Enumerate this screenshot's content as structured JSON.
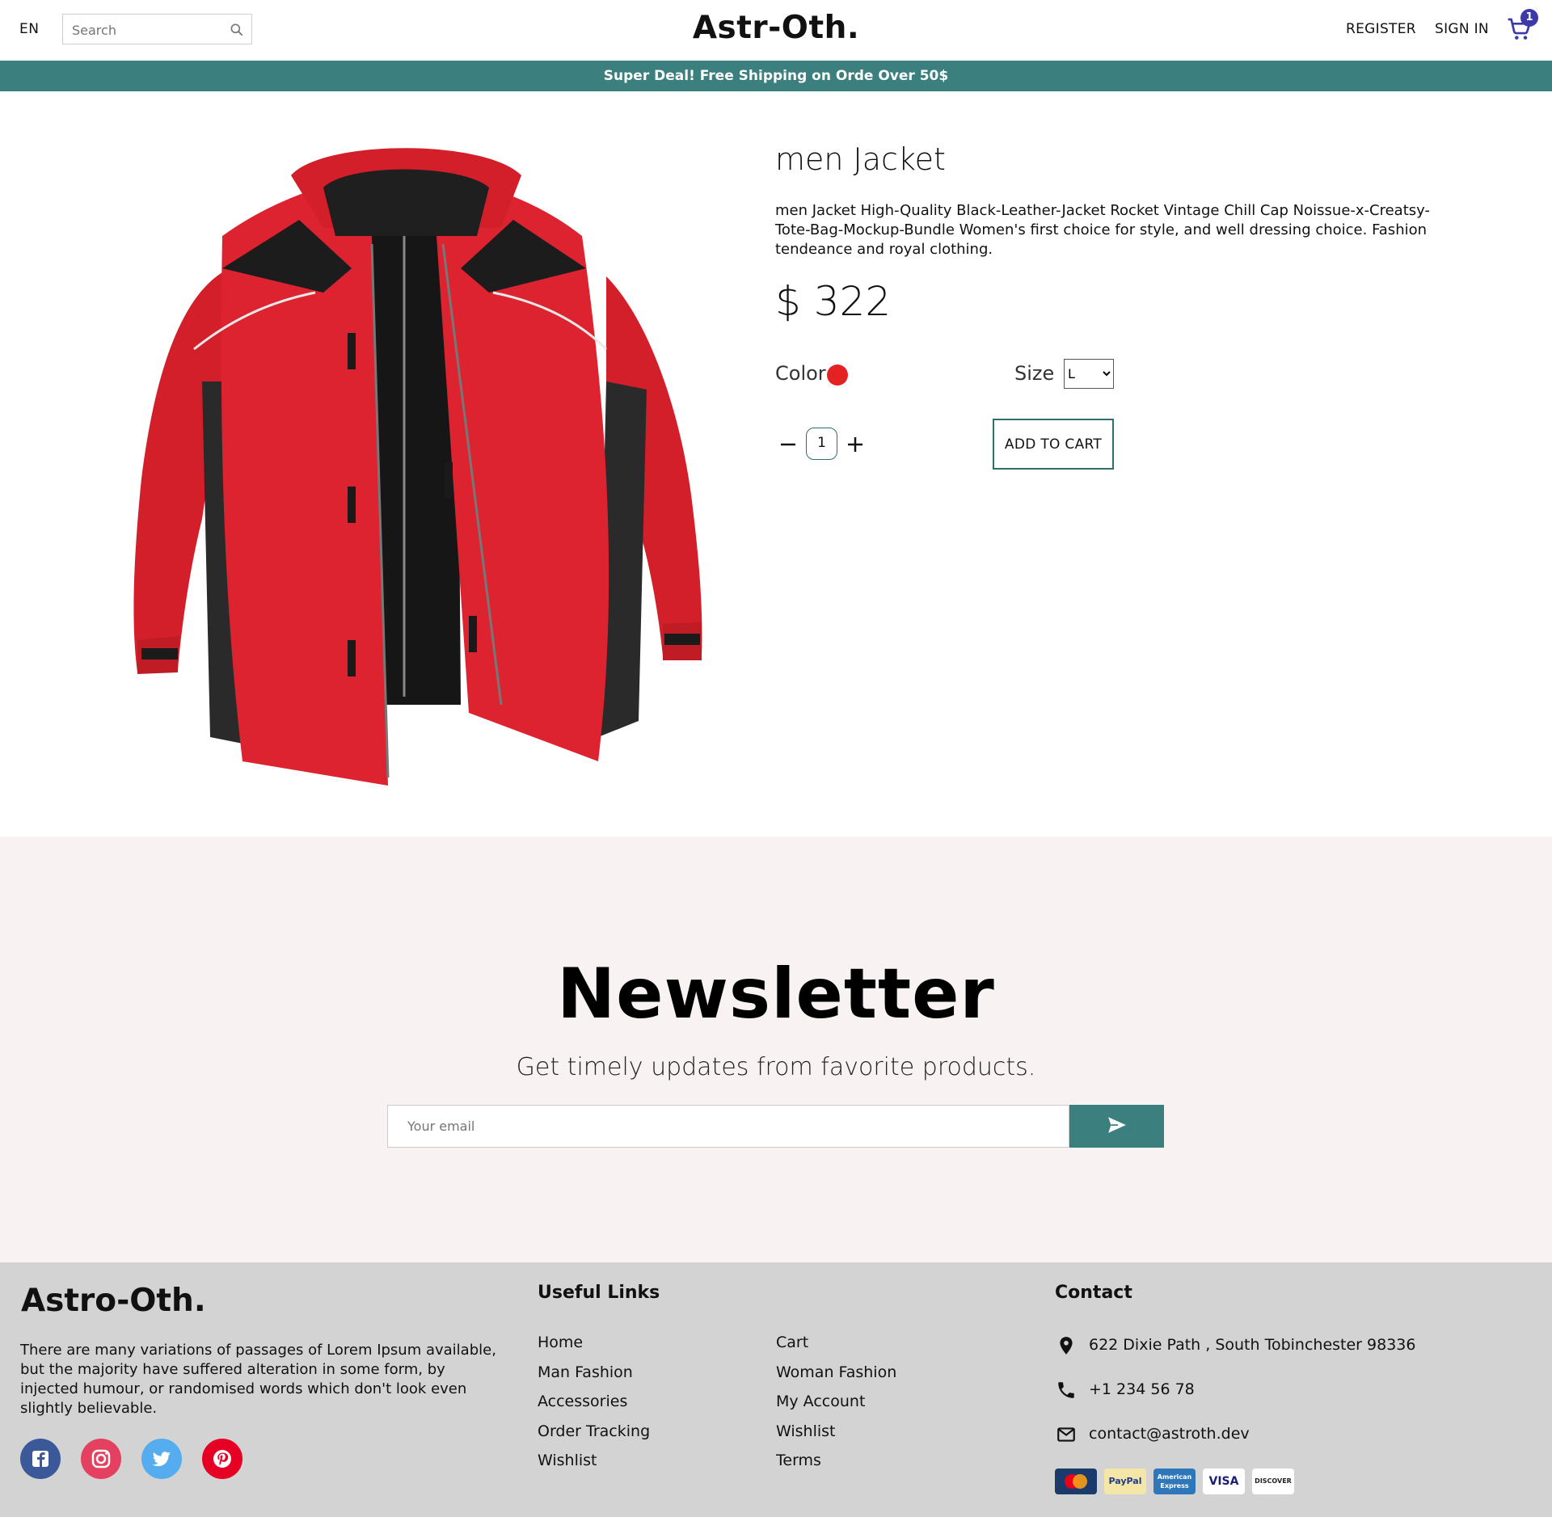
{
  "header": {
    "language": "EN",
    "search_placeholder": "Search",
    "logo": "Astr-Oth.",
    "register": "REGISTER",
    "sign_in": "SIGN IN",
    "cart_count": "1"
  },
  "announcement": "Super Deal! Free Shipping on Orde Over 50$",
  "product": {
    "title": "men Jacket",
    "description": "men Jacket High-Quality Black-Leather-Jacket Rocket Vintage Chill Cap Noissue-x-Creatsy-Tote-Bag-Mockup-Bundle Women's first choice for style, and well dressing choice. Fashion tendeance and royal clothing.",
    "price": "$ 322",
    "color_label": "Color",
    "color_value": "#e52222",
    "size_label": "Size",
    "size_selected": "L",
    "quantity": "1",
    "add_to_cart": "ADD TO CART"
  },
  "newsletter": {
    "title": "Newsletter",
    "subtitle": "Get timely updates from favorite products.",
    "email_placeholder": "Your email"
  },
  "footer": {
    "logo": "Astro-Oth.",
    "about": "There are many variations of passages of Lorem Ipsum available, but the majority have suffered alteration in some form, by injected humour, or randomised words which don't look even slightly believable.",
    "useful_links_heading": "Useful Links",
    "links_col1": [
      "Home",
      "Man Fashion",
      "Accessories",
      "Order Tracking",
      "Wishlist"
    ],
    "links_col2": [
      "Cart",
      "Woman Fashion",
      "My Account",
      "Wishlist",
      "Terms"
    ],
    "contact_heading": "Contact",
    "address": "622 Dixie Path , South Tobinchester 98336",
    "phone": "+1 234 56 78",
    "email": "contact@astroth.dev",
    "payments": [
      "MasterCard",
      "PayPal",
      "American Express",
      "VISA",
      "DISCOVER"
    ]
  },
  "colors": {
    "accent": "#3b7f7e",
    "cart_badge": "#3b3aa8",
    "newsletter_bg": "#f8f3f2",
    "footer_bg": "#d3d3d3"
  }
}
